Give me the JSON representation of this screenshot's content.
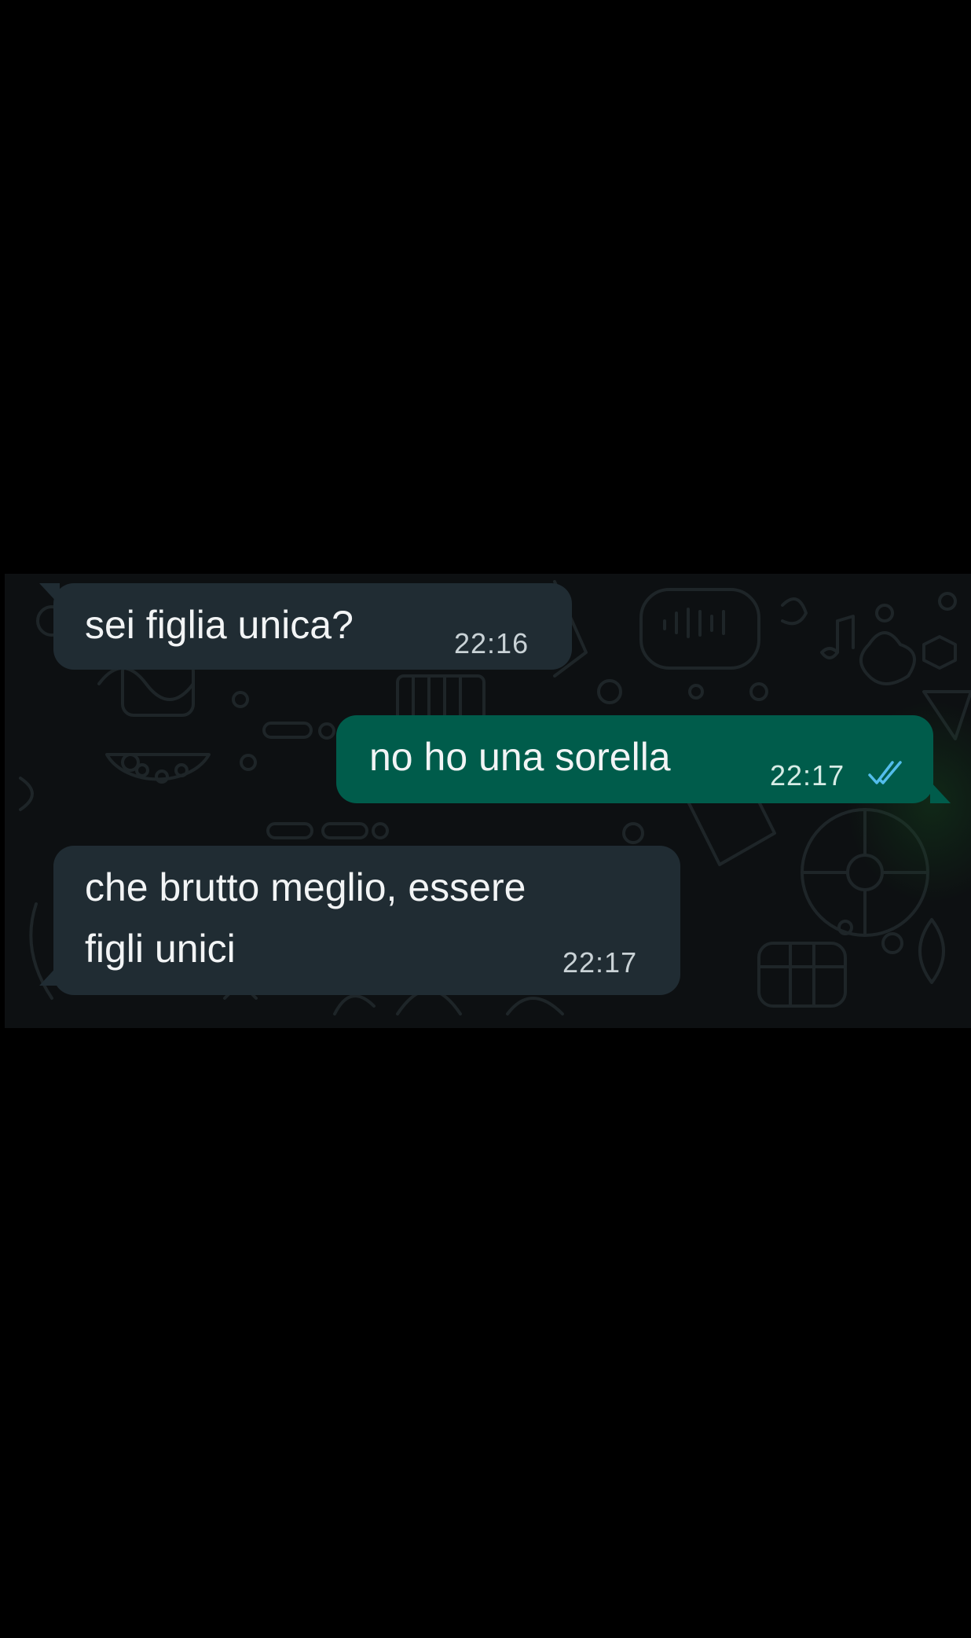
{
  "chat": {
    "messages": [
      {
        "direction": "incoming",
        "text": "sei figlia unica?",
        "time": "22:16"
      },
      {
        "direction": "outgoing",
        "text": "no ho una sorella",
        "time": "22:17",
        "status": "read",
        "status_icon": "double-check-icon",
        "status_color": "#53bdeb"
      },
      {
        "direction": "incoming",
        "text_lines": [
          "che brutto meglio, essere",
          "figli unici"
        ],
        "time": "22:17"
      }
    ]
  },
  "colors": {
    "page_background": "#000000",
    "chat_background": "#0d1012",
    "incoming_bubble": "#202c33",
    "outgoing_bubble": "#005c4b",
    "read_ticks": "#53bdeb"
  }
}
